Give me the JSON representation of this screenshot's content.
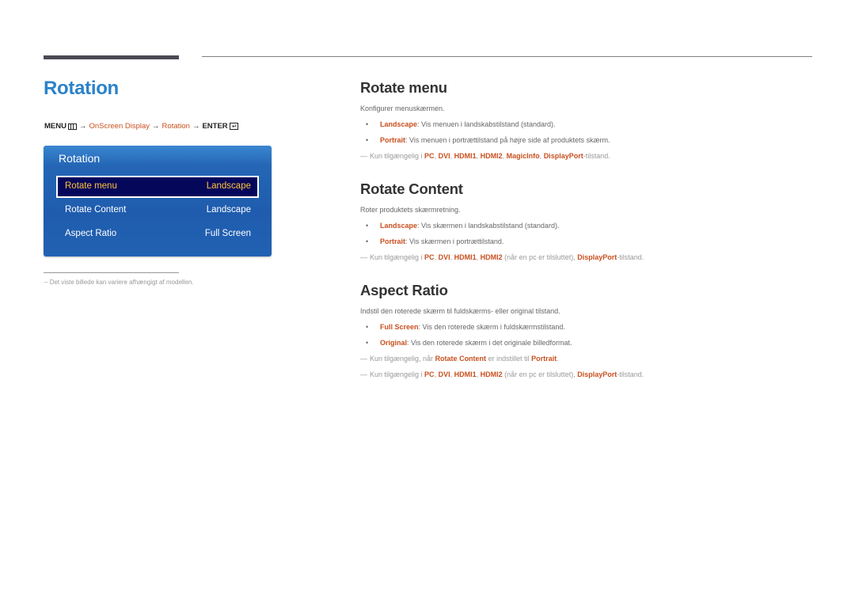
{
  "page": {
    "title": "Rotation"
  },
  "breadcrumb": {
    "menu": "MENU",
    "menu_icon": "menu-grid-icon",
    "arrow": "→",
    "item1": "OnScreen Display",
    "item2": "Rotation",
    "enter": "ENTER",
    "enter_icon": "enter-icon"
  },
  "osd": {
    "title": "Rotation",
    "rows": [
      {
        "label": "Rotate menu",
        "value": "Landscape",
        "selected": true
      },
      {
        "label": "Rotate Content",
        "value": "Landscape",
        "selected": false
      },
      {
        "label": "Aspect Ratio",
        "value": "Full Screen",
        "selected": false
      }
    ]
  },
  "footnote": {
    "dash": "–",
    "text": "Det viste billede kan variere afhængigt af modellen."
  },
  "sections": {
    "rotate_menu": {
      "title": "Rotate menu",
      "intro": "Konfigurer menuskærmen.",
      "bullets": [
        {
          "term": "Landscape",
          "text": ": Vis menuen i landskabstilstand (standard)."
        },
        {
          "term": "Portrait",
          "text": ": Vis menuen i portrættilstand på højre side af produktets skærm."
        }
      ],
      "note": {
        "prefix": "Kun tilgængelig i ",
        "terms": [
          "PC",
          "DVI",
          "HDMI1",
          "HDMI2",
          "MagicInfo",
          "DisplayPort"
        ],
        "sep": ", ",
        "suffix": "-tilstand."
      }
    },
    "rotate_content": {
      "title": "Rotate Content",
      "intro": "Roter produktets skærmretning.",
      "bullets": [
        {
          "term": "Landscape",
          "text": ": Vis skærmen i landskabstilstand (standard)."
        },
        {
          "term": "Portrait",
          "text": ": Vis skærmen i portrættilstand."
        }
      ],
      "note": {
        "prefix": "Kun tilgængelig i ",
        "t1": "PC",
        "t2": "DVI",
        "t3": "HDMI1",
        "t4": "HDMI2",
        "mid": " (når en pc er tilsluttet), ",
        "t5": "DisplayPort",
        "suffix": "-tilstand."
      }
    },
    "aspect_ratio": {
      "title": "Aspect Ratio",
      "intro": "Indstil den roterede skærm til fuldskærms- eller original tilstand.",
      "bullets": [
        {
          "term": "Full Screen",
          "text": ": Vis den roterede skærm i fuldskærmstilstand."
        },
        {
          "term": "Original",
          "text": ": Vis den roterede skærm i det originale billedformat."
        }
      ],
      "note1": {
        "prefix": "Kun tilgængelig, når ",
        "t1": "Rotate Content",
        "mid": " er indstillet til ",
        "t2": "Portrait",
        "suffix": "."
      },
      "note2": {
        "prefix": "Kun tilgængelig i ",
        "t1": "PC",
        "t2": "DVI",
        "t3": "HDMI1",
        "t4": "HDMI2",
        "mid": " (når en pc er tilsluttet), ",
        "t5": "DisplayPort",
        "suffix": "-tilstand."
      }
    }
  },
  "symbols": {
    "bullet": "•",
    "note_dash": "—",
    "comma": ", "
  },
  "colors": {
    "title_blue": "#2b82c9",
    "highlight_orange": "#c8501f",
    "osd_blue": "#2261b2",
    "osd_selected_bg": "#05075a",
    "osd_selected_text": "#ffc43a"
  }
}
